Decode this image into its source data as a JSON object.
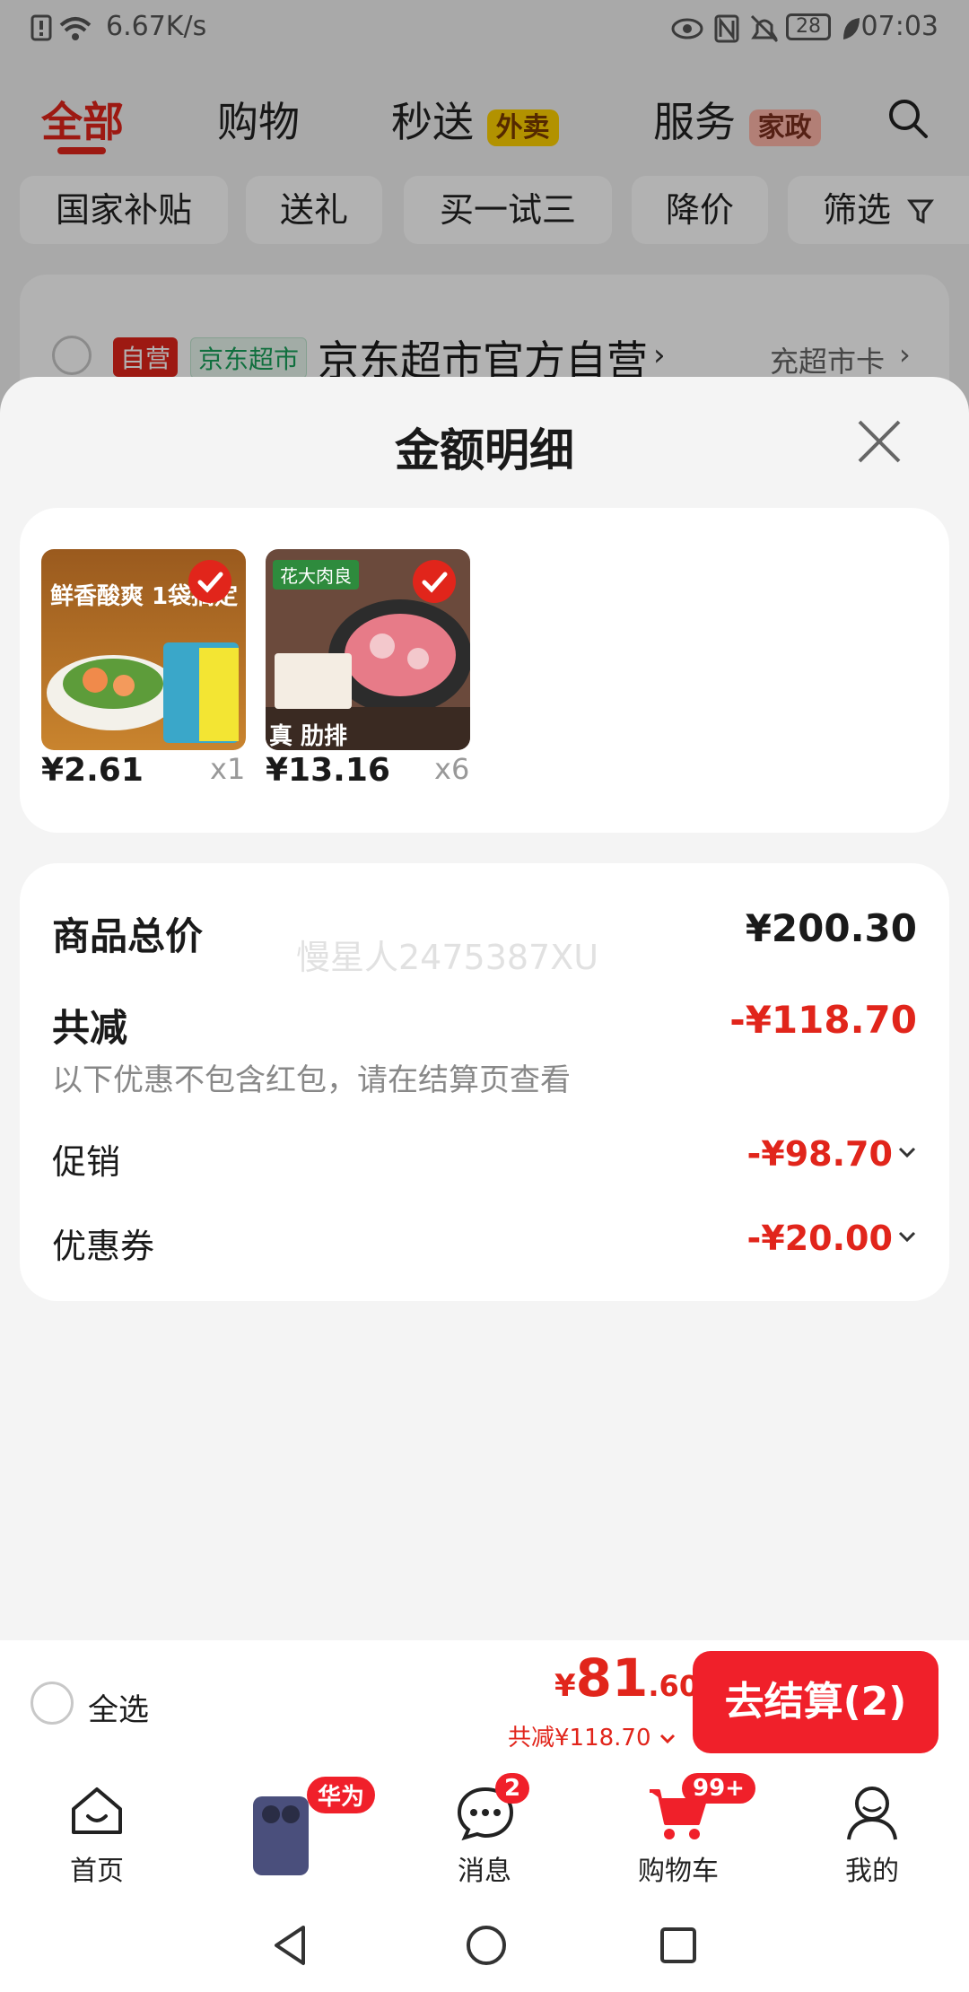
{
  "status_bar": {
    "speed": "6.67K/s",
    "battery": "28",
    "time": "07:03"
  },
  "top_tabs": [
    {
      "label": "全部"
    },
    {
      "label": "购物"
    },
    {
      "label": "秒送",
      "tag": "外卖"
    },
    {
      "label": "服务",
      "tag": "家政"
    }
  ],
  "filter_chips": [
    "国家补贴",
    "送礼",
    "买一试三",
    "降价",
    "筛选"
  ],
  "store": {
    "badge_self": "自营",
    "badge_market": "京东超市",
    "name": "京东超市官方自营",
    "card_link": "充超市卡"
  },
  "sheet": {
    "title": "金额明细",
    "products": [
      {
        "thumb_text": "鲜香酸爽 1袋搞定",
        "price": "¥2.61",
        "qty": "x1"
      },
      {
        "thumb_text": "花大肉良",
        "thumb_sub": "真 肋排",
        "price": "¥13.16",
        "qty": "x6"
      }
    ],
    "summary": {
      "total_label": "商品总价",
      "total_value": "¥200.30",
      "discount_label": "共减",
      "discount_value": "-¥118.70",
      "discount_note": "以下优惠不包含红包，请在结算页查看",
      "promo_label": "促销",
      "promo_value": "-¥98.70",
      "coupon_label": "优惠券",
      "coupon_value": "-¥20.00"
    },
    "watermark": "慢星人2475387XU"
  },
  "bottom_bar": {
    "select_all": "全选",
    "currency": "¥",
    "price_int": "81",
    "price_dec": ".60",
    "discount_text": "共减¥118.70",
    "checkout_label": "去结算(2)"
  },
  "nav": {
    "home": "首页",
    "promo_badge": "华为",
    "messages": "消息",
    "messages_badge": "2",
    "cart": "购物车",
    "cart_badge": "99+",
    "mine": "我的"
  },
  "colors": {
    "accent": "#e1251b",
    "button": "#f0202a"
  }
}
